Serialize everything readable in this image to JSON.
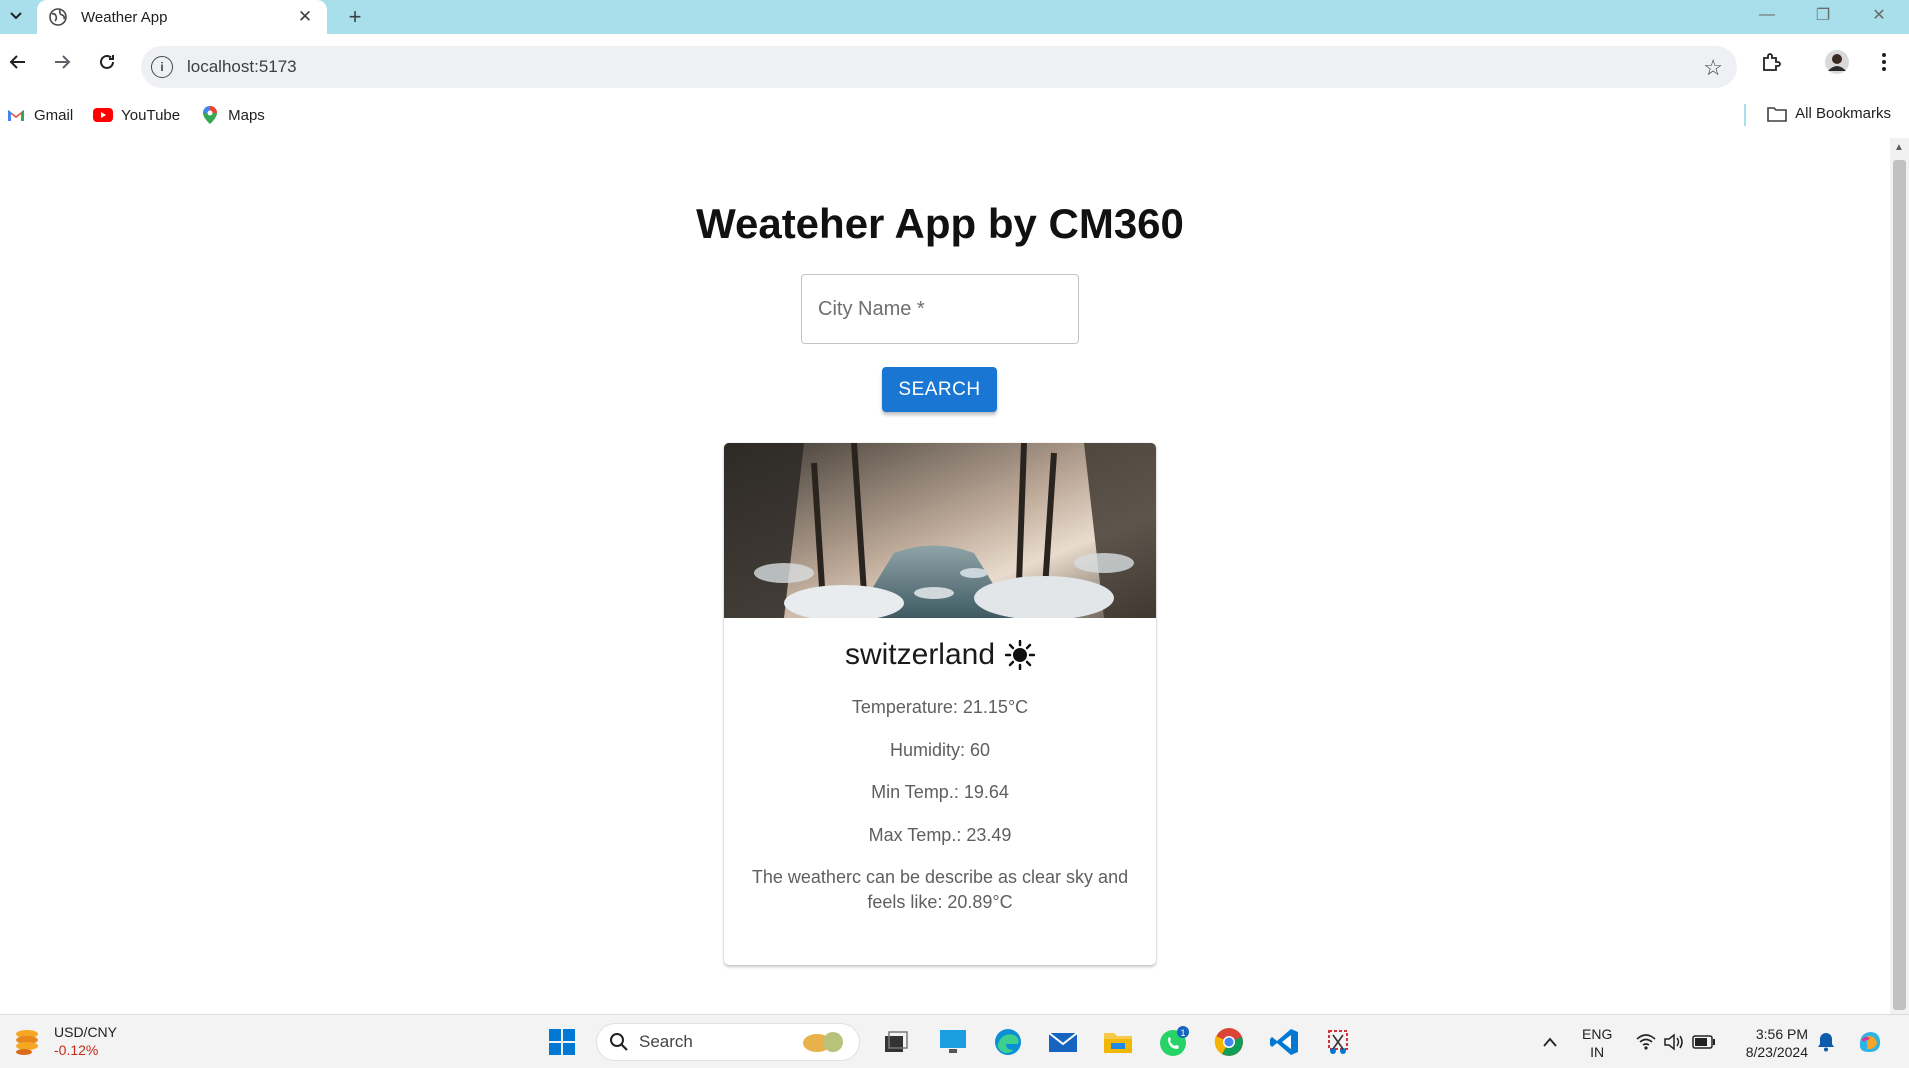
{
  "browser": {
    "tab_title": "Weather App",
    "url": "localhost:5173",
    "bookmarks": [
      {
        "label": "Gmail",
        "icon": "gmail-icon"
      },
      {
        "label": "YouTube",
        "icon": "youtube-icon"
      },
      {
        "label": "Maps",
        "icon": "maps-icon"
      }
    ],
    "all_bookmarks_label": "All Bookmarks"
  },
  "app": {
    "title": "Weateher App by CM360",
    "city_placeholder": "City Name *",
    "search_label": "SEARCH",
    "accent_color": "#1976d2"
  },
  "weather_card": {
    "city": "switzerland",
    "condition_icon": "sun-icon",
    "temperature": "Temperature: 21.15°C",
    "humidity": "Humidity: 60",
    "min_temp": "Min Temp.: 19.64",
    "max_temp": "Max Temp.: 23.49",
    "description": "The weatherc can be describe as clear sky and feels like: 20.89°C"
  },
  "taskbar": {
    "ticker_name": "USD/CNY",
    "ticker_change": "-0.12%",
    "search_label": "Search",
    "language": "ENG",
    "region": "IN",
    "time": "3:56 PM",
    "date": "8/23/2024",
    "whatsapp_badge": "1"
  }
}
